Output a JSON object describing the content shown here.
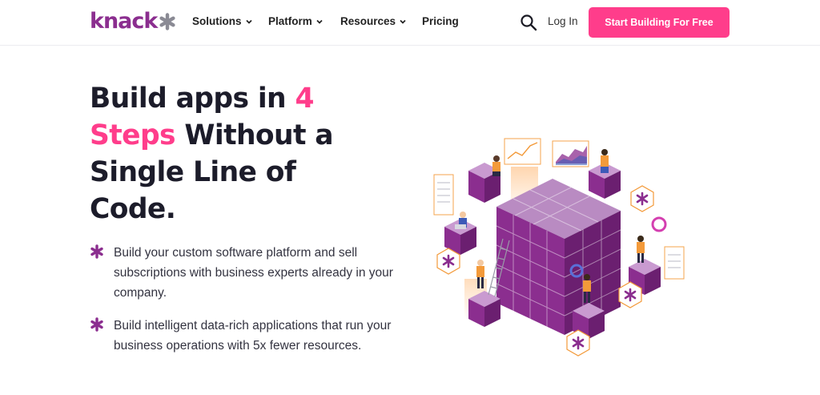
{
  "brand": {
    "name": "knack",
    "color": "#8b2e8f"
  },
  "nav": {
    "items": [
      {
        "label": "Solutions",
        "has_dropdown": true
      },
      {
        "label": "Platform",
        "has_dropdown": true
      },
      {
        "label": "Resources",
        "has_dropdown": true
      },
      {
        "label": "Pricing",
        "has_dropdown": false
      }
    ],
    "search_icon": "search-icon",
    "login_label": "Log In",
    "cta_label": "Start Building For Free",
    "cta_color": "#ff3d8b"
  },
  "hero": {
    "title_part1": "Build apps in ",
    "title_accent": "4 Steps",
    "title_part2": " Without a Single Line of Code.",
    "accent_color": "#ff3d8b",
    "bullets": [
      {
        "icon": "asterisk-icon",
        "text": "Build your custom software platform and sell subscriptions with business experts already in your company."
      },
      {
        "icon": "asterisk-icon",
        "text": "Build intelligent data-rich applications that run your business operations with 5x fewer resources."
      }
    ]
  },
  "illustration": {
    "icon": "isometric-cube-illustration",
    "primary_color": "#8b2e8f",
    "accent_color": "#f39a3a"
  }
}
